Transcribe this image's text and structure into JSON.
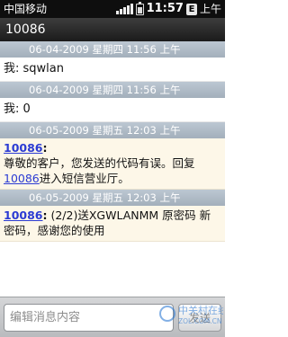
{
  "status_bar": {
    "carrier": "中国移动",
    "time": "11:57",
    "network_badge": "E",
    "ampm": "上午"
  },
  "header": {
    "title": "10086"
  },
  "conversation": {
    "link_color": "#2b3bd3",
    "messages": [
      {
        "date": "06-04-2009 星期四 11:56 上午",
        "type": "sent",
        "prefix": "我: ",
        "text": "sqwlan"
      },
      {
        "date": "06-04-2009 星期四 11:56 上午",
        "type": "sent",
        "prefix": "我: ",
        "text": "0"
      },
      {
        "date": "06-05-2009 星期五 12:03 上午",
        "type": "received",
        "sender": "10086",
        "colon": ":",
        "text_a": "尊敬的客户，您发送的代码有误。回复",
        "link": "10086",
        "text_b": "进入短信营业厅。"
      },
      {
        "date": "06-05-2009 星期五 12:03 上午",
        "type": "received",
        "sender": "10086",
        "colon": ":",
        "text": " (2/2)送XGWLANMM 原密码 新密码，感谢您的使用"
      }
    ]
  },
  "compose": {
    "placeholder": "编辑消息内容",
    "send_label": "发送"
  },
  "watermark": {
    "line1": "中关村在线",
    "line2": "ZOL.COM.CN"
  }
}
